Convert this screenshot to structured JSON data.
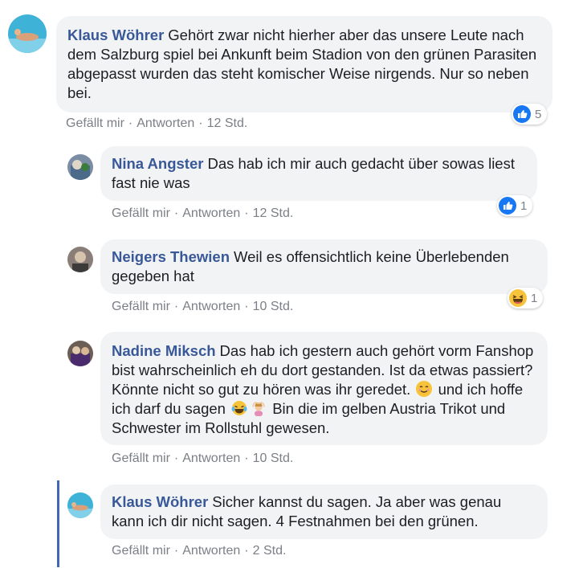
{
  "colors": {
    "name_link": "#385898",
    "bubble_bg": "#f2f3f5",
    "meta": "#7b7f86",
    "like_blue": "#1877f2",
    "thread_accent": "#4267b2"
  },
  "comments": [
    {
      "name": "Klaus Wöhrer",
      "text": "Gehört zwar nicht hierher aber das unsere Leute nach dem Salzburg spiel bei Ankunft beim Stadion von den grünen Parasiten abgepasst wurden das steht komischer Weise nirgends. Nur so neben bei.",
      "like": "Gefällt mir",
      "reply": "Antworten",
      "time": "12 Std.",
      "reaction": {
        "icon": "like-icon",
        "count": "5"
      }
    },
    {
      "name": "Nina Angster",
      "text": "Das hab ich mir auch gedacht über sowas liest fast nie was",
      "like": "Gefällt mir",
      "reply": "Antworten",
      "time": "12 Std.",
      "reaction": {
        "icon": "like-icon",
        "count": "1"
      }
    },
    {
      "name": "Neigers Thewien",
      "text": "Weil es offensichtlich keine Überlebenden gegeben hat",
      "like": "Gefällt mir",
      "reply": "Antworten",
      "time": "10 Std.",
      "reaction": {
        "icon": "haha-icon",
        "count": "1"
      }
    },
    {
      "name": "Nadine Miksch",
      "text1": "Das hab ich gestern auch gehört vorm Fanshop bist wahrscheinlich eh du dort gestanden. Ist da etwas passiert? Könnte nicht so gut zu hören was ihr geredet.",
      "text2": "und ich hoffe ich darf du sagen",
      "text3": "Bin die im gelben Austria Trikot und Schwester im Rollstuhl gewesen.",
      "emojis": [
        "smiling-face-emoji",
        "tears-of-joy-emoji",
        "person-gesturing-ok-emoji"
      ],
      "like": "Gefällt mir",
      "reply": "Antworten",
      "time": "10 Std."
    },
    {
      "name": "Klaus Wöhrer",
      "text": "Sicher kannst du sagen. Ja aber was genau kann ich dir nicht sagen. 4 Festnahmen bei den grünen.",
      "like": "Gefällt mir",
      "reply": "Antworten",
      "time": "2 Std."
    }
  ]
}
